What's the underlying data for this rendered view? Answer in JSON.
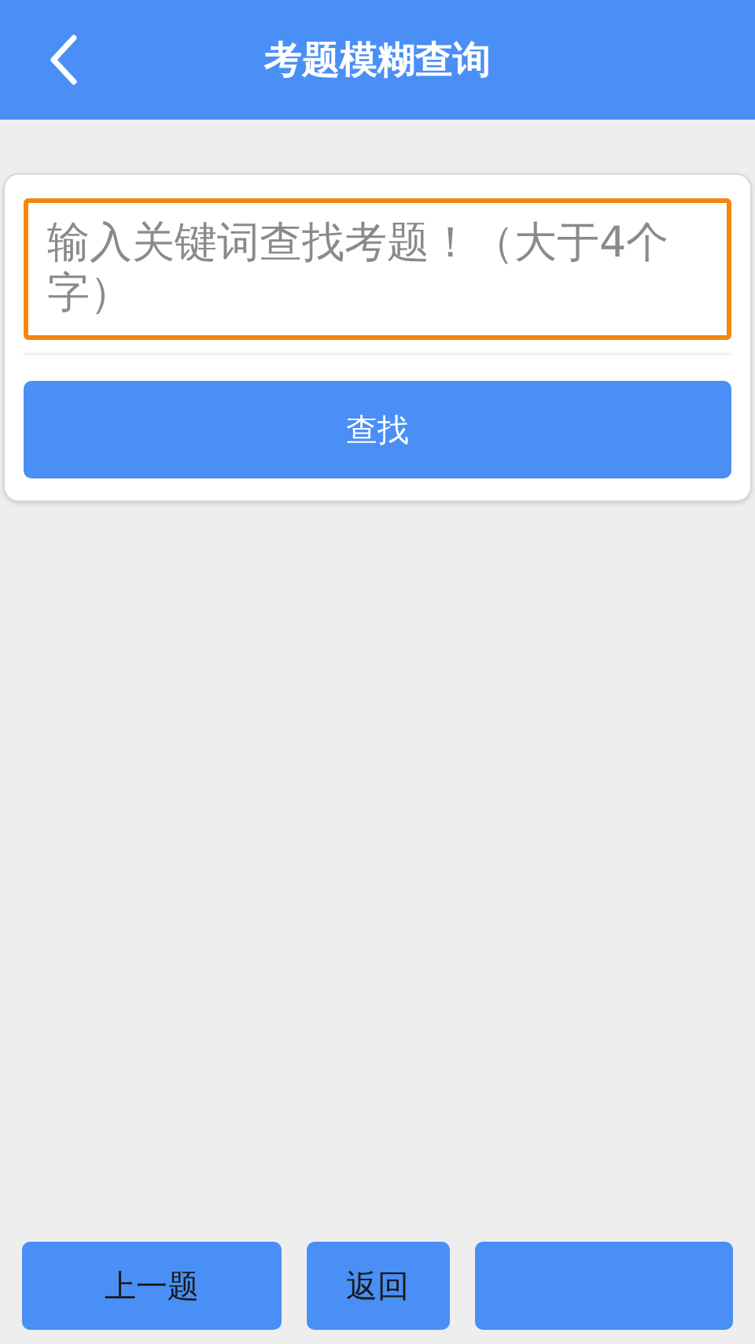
{
  "header": {
    "title": "考题模糊查询"
  },
  "search": {
    "placeholder": "输入关键词查找考题！（大于4个字）",
    "focused": true,
    "button": "查找"
  },
  "bottom_buttons": [
    {
      "kind": "text",
      "label": "上一题"
    },
    {
      "kind": "text",
      "label": "返回"
    },
    {
      "kind": "blank"
    }
  ]
}
